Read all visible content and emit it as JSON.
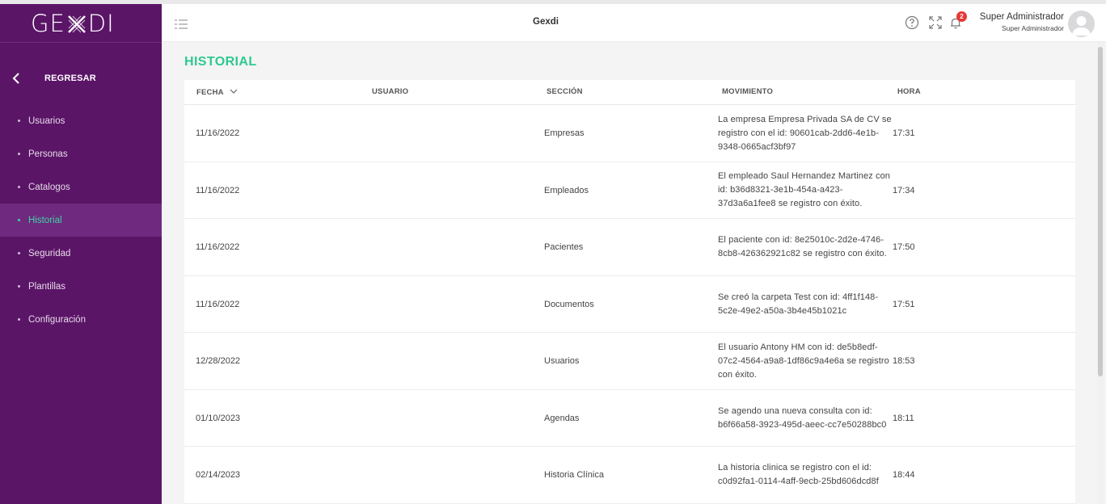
{
  "brand": {
    "logo_text_left": "GE",
    "logo_text_right": "DI"
  },
  "sidebar": {
    "back_label": "REGRESAR",
    "items": [
      {
        "label": "Usuarios",
        "active": false
      },
      {
        "label": "Personas",
        "active": false
      },
      {
        "label": "Catalogos",
        "active": false
      },
      {
        "label": "Historial",
        "active": true
      },
      {
        "label": "Seguridad",
        "active": false
      },
      {
        "label": "Plantillas",
        "active": false
      },
      {
        "label": "Configuración",
        "active": false
      }
    ]
  },
  "header": {
    "title": "Gexdi",
    "notification_count": "2",
    "user_name": "Super Administrador",
    "user_role": "Super Administrador",
    "icons": [
      "menu-toggle-icon",
      "help-icon",
      "fullscreen-icon",
      "bell-icon",
      "avatar"
    ]
  },
  "main": {
    "page_title": "HISTORIAL",
    "columns": [
      "FECHA",
      "USUARIO",
      "SECCIÓN",
      "MOVIMIENTO",
      "HORA"
    ],
    "rows": [
      {
        "fecha": "11/16/2022",
        "usuario": "",
        "seccion": "Empresas",
        "movimiento": "La empresa Empresa Privada SA de CV se registro con el id: 90601cab-2dd6-4e1b-9348-0665acf3bf97",
        "hora": "17:31"
      },
      {
        "fecha": "11/16/2022",
        "usuario": "",
        "seccion": "Empleados",
        "movimiento": "El empleado Saul Hernandez Martinez con id: b36d8321-3e1b-454a-a423-37d3a6a1fee8 se registro con éxito.",
        "hora": "17:34"
      },
      {
        "fecha": "11/16/2022",
        "usuario": "",
        "seccion": "Pacientes",
        "movimiento": "El paciente con id: 8e25010c-2d2e-4746-8cb8-426362921c82 se registro con éxito.",
        "hora": "17:50"
      },
      {
        "fecha": "11/16/2022",
        "usuario": "",
        "seccion": "Documentos",
        "movimiento": "Se creó la carpeta Test con id: 4ff1f148-5c2e-49e2-a50a-3b4e45b1021c",
        "hora": "17:51"
      },
      {
        "fecha": "12/28/2022",
        "usuario": "",
        "seccion": "Usuarios",
        "movimiento": "El usuario Antony HM con id: de5b8edf-07c2-4564-a9a8-1df86c9a4e6a se registro con éxito.",
        "hora": "18:53"
      },
      {
        "fecha": "01/10/2023",
        "usuario": "",
        "seccion": "Agendas",
        "movimiento": "Se agendo una nueva consulta con id: b6f66a58-3923-495d-aeec-cc7e50288bc0",
        "hora": "18:11"
      },
      {
        "fecha": "02/14/2023",
        "usuario": "",
        "seccion": "Historia Clínica",
        "movimiento": "La historia clinica se registro con el id: c0d92fa1-0114-4aff-9ecb-25bd606dcd8f",
        "hora": "18:44"
      }
    ]
  },
  "colors": {
    "sidebar_bg": "#5b1567",
    "sidebar_active_bg": "#6f2a80",
    "accent_green": "#2ec98f",
    "badge_red": "#e53935"
  }
}
